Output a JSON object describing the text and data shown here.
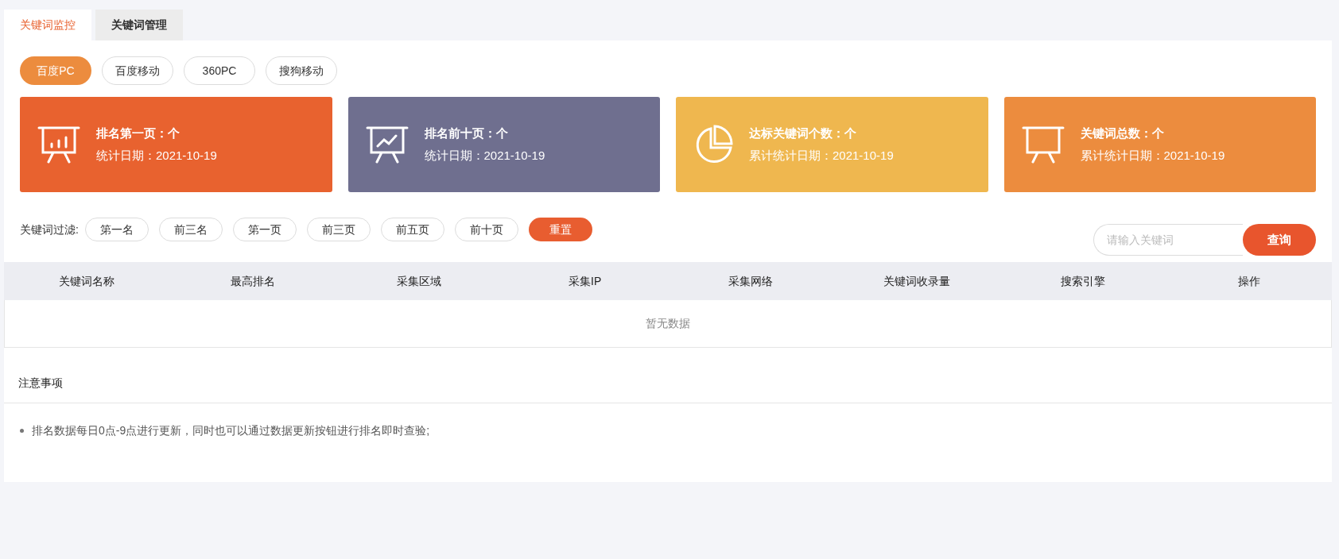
{
  "tabs": [
    {
      "label": "关键词监控",
      "selected": true
    },
    {
      "label": "关键词管理",
      "selected": false
    }
  ],
  "engines": [
    {
      "label": "百度PC",
      "selected": true
    },
    {
      "label": "百度移动",
      "selected": false
    },
    {
      "label": "360PC",
      "selected": false
    },
    {
      "label": "搜狗移动",
      "selected": false
    }
  ],
  "cards": [
    {
      "kind": "bars",
      "color": "#e8622f",
      "title": "排名第一页：个",
      "date": "统计日期：2021-10-19"
    },
    {
      "kind": "line",
      "color": "#6f6f8f",
      "title": "排名前十页：个",
      "date": "统计日期：2021-10-19"
    },
    {
      "kind": "pie",
      "color": "#efb74f",
      "title": "达标关键词个数：个",
      "date": "累计统计日期：2021-10-19"
    },
    {
      "kind": "board",
      "color": "#ec8c3e",
      "title": "关键词总数：个",
      "date": "累计统计日期：2021-10-19"
    }
  ],
  "filter": {
    "label": "关键词过滤:",
    "options": [
      {
        "label": "第一名",
        "selected": false
      },
      {
        "label": "前三名",
        "selected": false
      },
      {
        "label": "第一页",
        "selected": false
      },
      {
        "label": "前三页",
        "selected": false
      },
      {
        "label": "前五页",
        "selected": false
      },
      {
        "label": "前十页",
        "selected": false
      }
    ],
    "reset": "重置"
  },
  "search": {
    "placeholder": "请输入关键词",
    "button": "查询"
  },
  "table": {
    "columns": [
      "关键词名称",
      "最高排名",
      "采集区域",
      "采集IP",
      "采集网络",
      "关键词收录量",
      "搜索引擎",
      "操作"
    ],
    "empty": "暂无数据"
  },
  "notes": {
    "title": "注意事项",
    "items": [
      "排名数据每日0点-9点进行更新，同时也可以通过数据更新按钮进行排名即时查验;"
    ]
  }
}
